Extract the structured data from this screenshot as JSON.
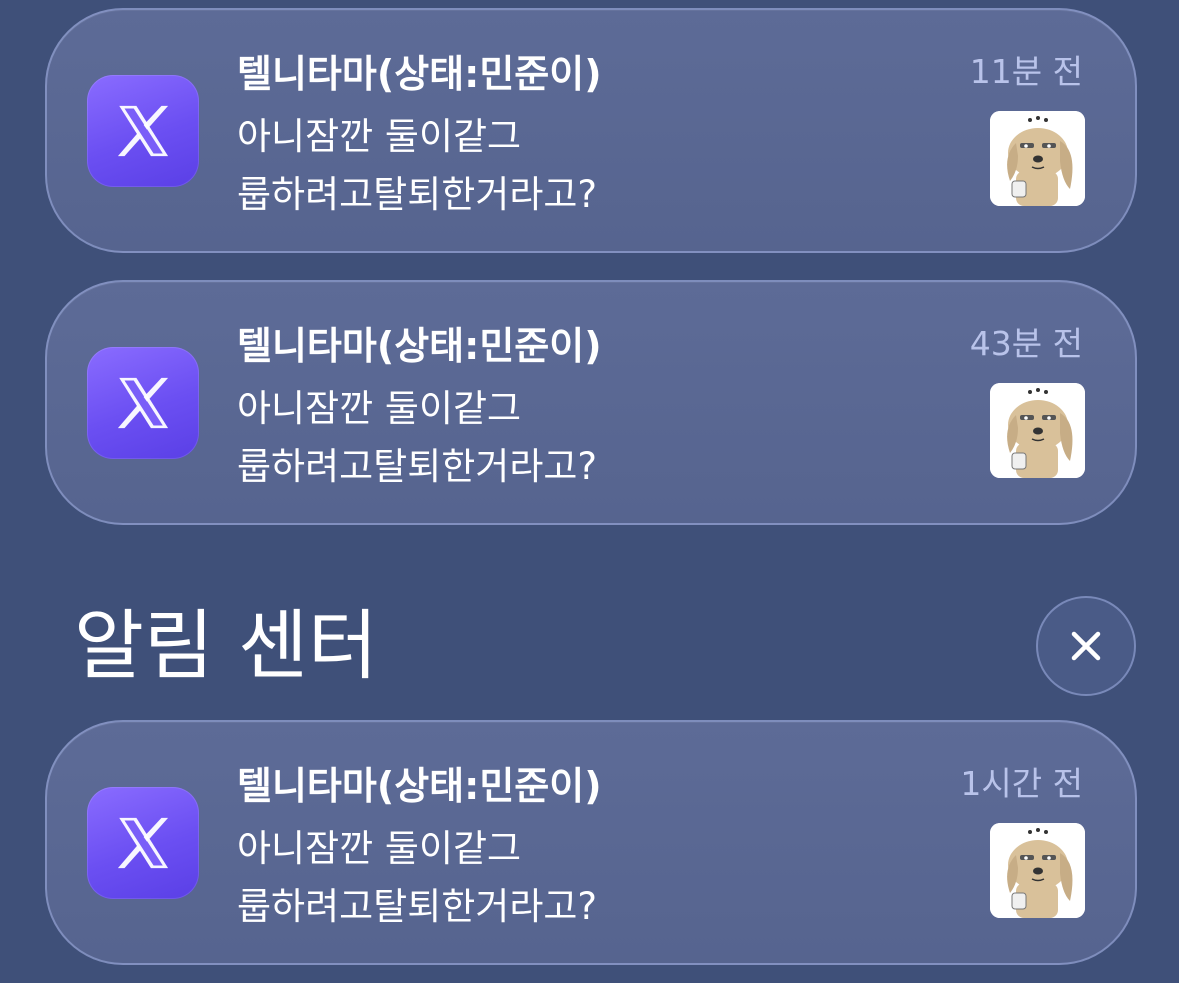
{
  "colors": {
    "background": "#3f5079",
    "card": "#5a6893",
    "app_icon": "#7055f5",
    "time_text": "#b9c3ea"
  },
  "notifications": [
    {
      "app_icon": "x-logo-icon",
      "title": "텔니타마(상태:민준이)",
      "body_line1": "아니잠깐 둘이같그",
      "body_line2": "룹하려고탈퇴한거라고?",
      "time": "11분 전",
      "thumbnail": "dog-sticker-icon"
    },
    {
      "app_icon": "x-logo-icon",
      "title": "텔니타마(상태:민준이)",
      "body_line1": "아니잠깐 둘이같그",
      "body_line2": "룹하려고탈퇴한거라고?",
      "time": "43분 전",
      "thumbnail": "dog-sticker-icon"
    }
  ],
  "notification_center": {
    "title": "알림 센터",
    "close_icon": "close-icon",
    "items": [
      {
        "app_icon": "x-logo-icon",
        "title": "텔니타마(상태:민준이)",
        "body_line1": "아니잠깐 둘이같그",
        "body_line2": "룹하려고탈퇴한거라고?",
        "time": "1시간 전",
        "thumbnail": "dog-sticker-icon"
      }
    ]
  }
}
